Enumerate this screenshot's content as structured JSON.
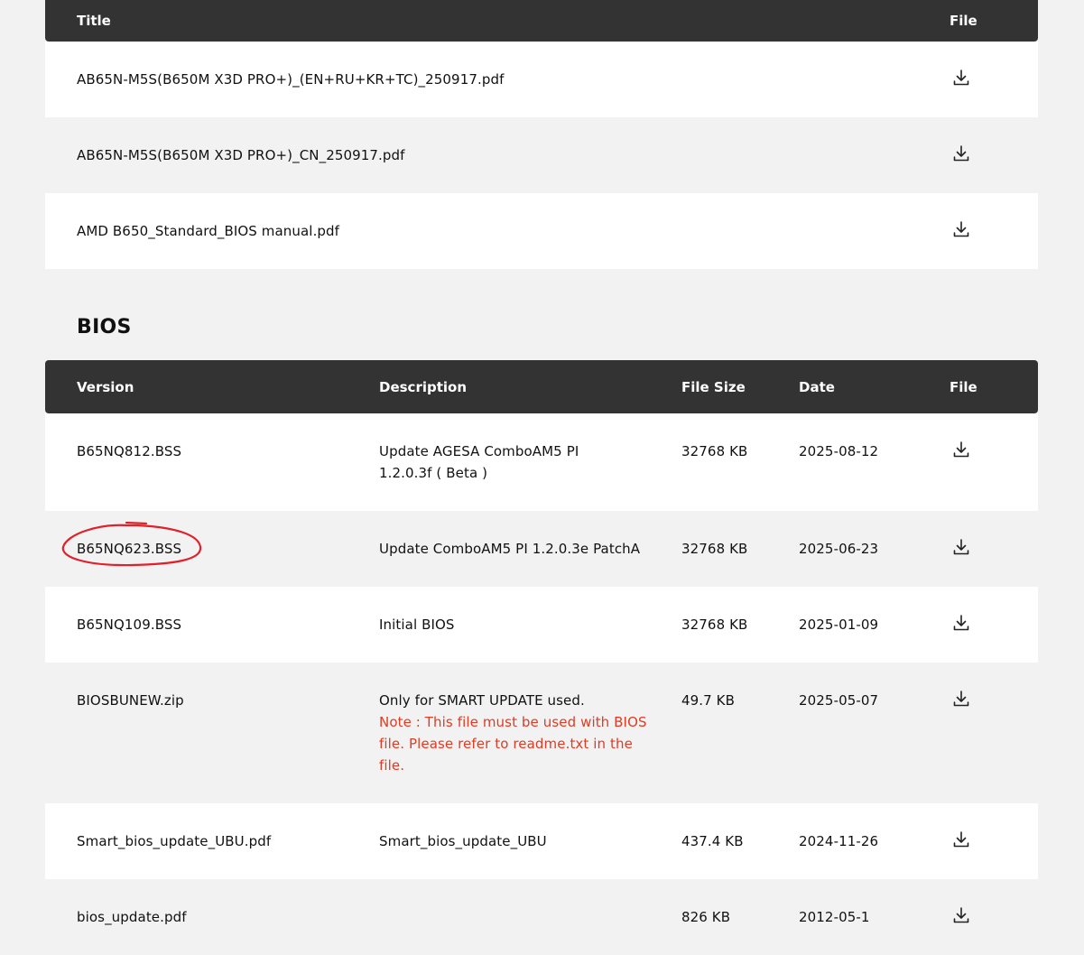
{
  "manuals": {
    "header": {
      "title": "Title",
      "file": "File"
    },
    "rows": [
      {
        "title": "AB65N-M5S(B650M X3D PRO+)_(EN+RU+KR+TC)_250917.pdf"
      },
      {
        "title": "AB65N-M5S(B650M X3D PRO+)_CN_250917.pdf"
      },
      {
        "title": "AMD B650_Standard_BIOS manual.pdf"
      }
    ]
  },
  "bios": {
    "heading": "BIOS",
    "header": {
      "version": "Version",
      "description": "Description",
      "size": "File Size",
      "date": "Date",
      "file": "File"
    },
    "rows": [
      {
        "version": "B65NQ812.BSS",
        "description": "Update AGESA ComboAM5 PI 1.2.0.3f ( Beta )",
        "note": "",
        "size": "32768 KB",
        "date": "2025-08-12"
      },
      {
        "version": "B65NQ623.BSS",
        "description": "Update ComboAM5 PI 1.2.0.3e PatchA",
        "note": "",
        "size": "32768 KB",
        "date": "2025-06-23"
      },
      {
        "version": "B65NQ109.BSS",
        "description": "Initial BIOS",
        "note": "",
        "size": "32768 KB",
        "date": "2025-01-09"
      },
      {
        "version": "BIOSBUNEW.zip",
        "description": "Only for SMART UPDATE used.",
        "note": "Note : This file must be used with BIOS file. Please refer to readme.txt in the file.",
        "size": "49.7 KB",
        "date": "2025-05-07"
      },
      {
        "version": "Smart_bios_update_UBU.pdf",
        "description": "Smart_bios_update_UBU",
        "note": "",
        "size": "437.4 KB",
        "date": "2024-11-26"
      },
      {
        "version": "bios_update.pdf",
        "description": "",
        "note": "",
        "size": "826 KB",
        "date": "2012-05-1"
      }
    ]
  },
  "icons": {
    "download": "download-icon"
  },
  "colors": {
    "header_bg": "#333333",
    "note": "#e03b24",
    "annotation": "#e0202a"
  }
}
